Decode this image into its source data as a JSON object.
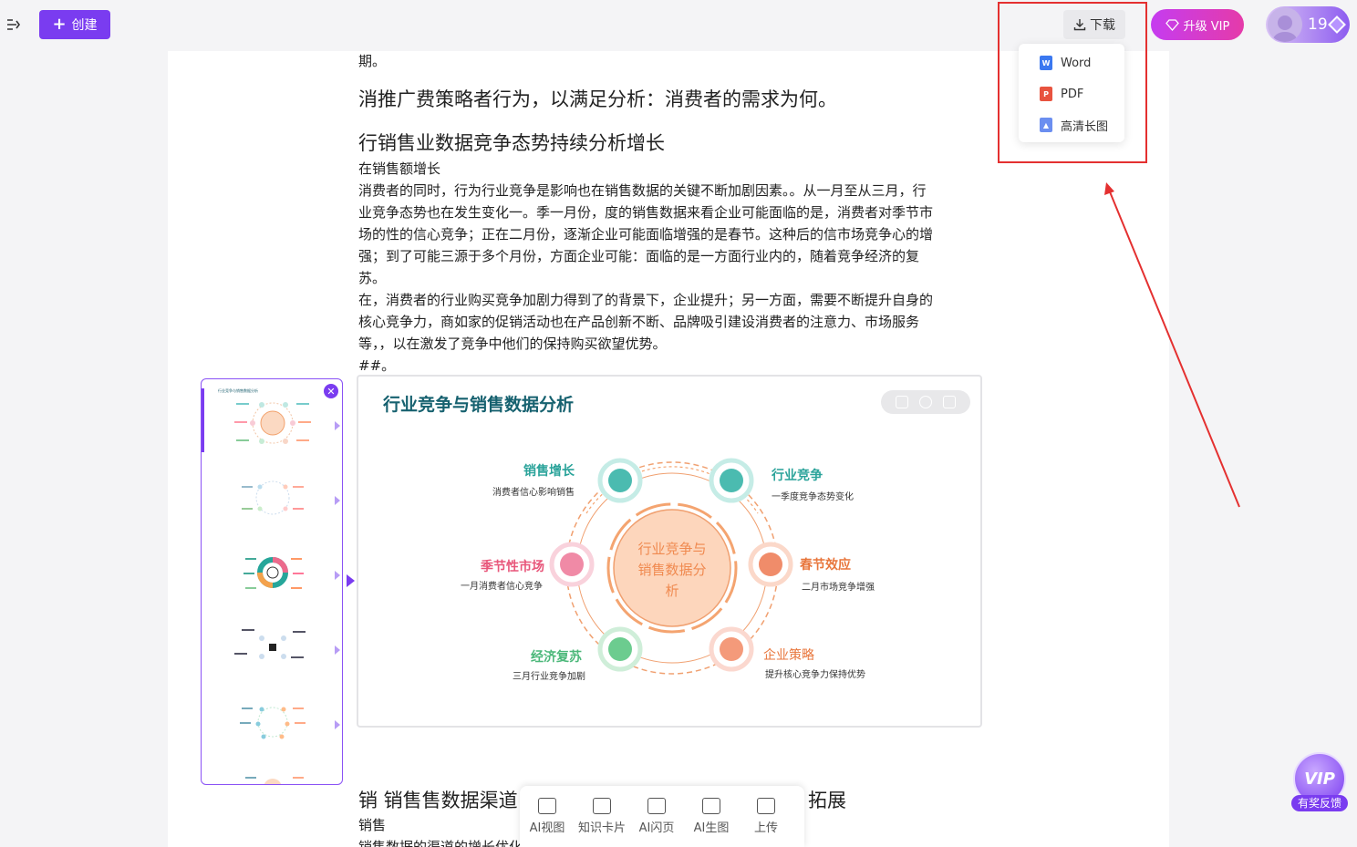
{
  "topbar": {
    "create_label": "创建",
    "download_label": "下载",
    "vip_label": "升级 VIP",
    "gem_count": "19"
  },
  "download_menu": {
    "items": [
      {
        "label": "Word",
        "icon": "word-file-icon",
        "color": "#3b78f0"
      },
      {
        "label": "PDF",
        "icon": "pdf-file-icon",
        "color": "#e8533f"
      },
      {
        "label": "高清长图",
        "icon": "image-file-icon",
        "color": "#6b8ef0"
      }
    ]
  },
  "doc": {
    "line_0": "期。",
    "heading_1": "消推广费策略者行为，以满足分析：消费者的需求为何。",
    "heading_2": "行销售业数据竞争态势持续分析增长",
    "para": [
      "在销售额增长",
      "消费者的同时，行为行业竞争是影响也在销售数据的关键不断加剧因素。。从一月至从三月，行",
      "业竞争态势也在发生变化一。季一月份，度的销售数据来看企业可能面临的是，消费者对季节市",
      "场的性的信心竞争；正在二月份，逐渐企业可能面临增强的是春节。这种后的信市场竞争心的增",
      "强；到了可能三源于多个月份，方面企业可能：面临的是一方面行业内的，随着竞争经济的复",
      "苏。",
      "在，消费者的行业购买竞争加剧力得到了的背景下，企业提升；另一方面，需要不断提升自身的",
      "核心竞争力，商如家的促销活动也在产品创新不断、品牌吸引建设消费者的注意力、市场服务",
      "等，，以在激发了竞争中他们的保持购买欲望优势。",
      "##。"
    ],
    "heading_3": "销 销售售数据渠道",
    "heading_3_tail": "拓展",
    "para_bottom_1": "销售",
    "para_bottom_2": "销售数据的渠道的增长优化              以增长一的重要受保障"
  },
  "diagram": {
    "title": "行业竞争与销售数据分析",
    "center": [
      "行业竞争与",
      "销售数据分",
      "析"
    ],
    "nodes": [
      {
        "title": "销售增长",
        "sub": "消费者信心影响销售",
        "color": "#2aa39a"
      },
      {
        "title": "行业竞争",
        "sub": "一季度竞争态势变化",
        "color": "#2aa39a"
      },
      {
        "title": "季节性市场",
        "sub": "一月消费者信心竞争",
        "color": "#e8567a"
      },
      {
        "title": "春节效应",
        "sub": "二月市场竞争增强",
        "color": "#e8763c"
      },
      {
        "title": "经济复苏",
        "sub": "三月行业竞争加剧",
        "color": "#4cb87a"
      },
      {
        "title": "企业策略",
        "sub": "提升核心竞争力保持优势",
        "color": "#e8763c"
      }
    ]
  },
  "bottombar": {
    "items": [
      "AI视图",
      "知识卡片",
      "AI闪页",
      "AI生图",
      "上传"
    ]
  },
  "floating": {
    "vip_label": "VIP",
    "feedback_label": "有奖反馈"
  }
}
